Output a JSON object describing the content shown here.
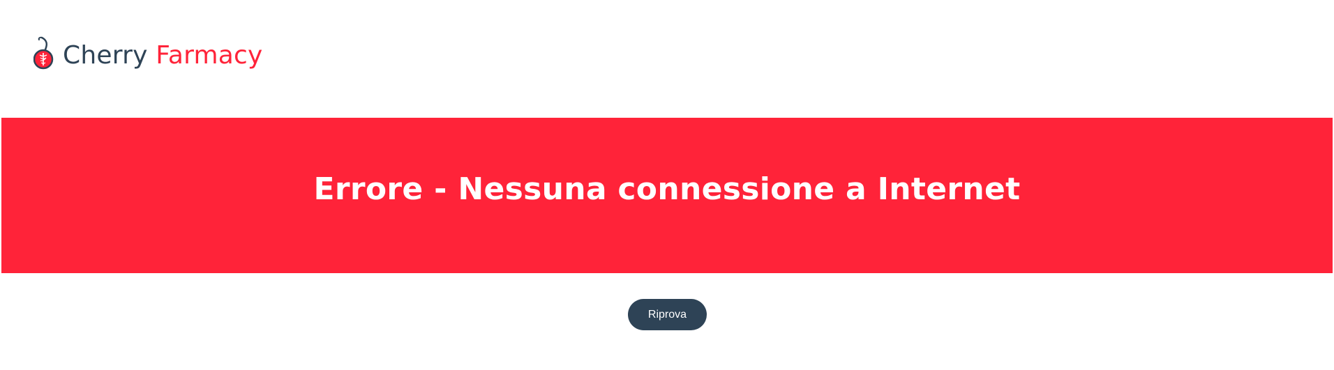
{
  "brand": {
    "name_part1": "Cherry",
    "name_part2": "Farmacy",
    "logo_icon": "cherry-caduceus-icon",
    "colors": {
      "dark": "#2e4356",
      "accent": "#ff2339"
    }
  },
  "banner": {
    "title": "Errore - Nessuna connessione a Internet",
    "background": "#ff2339"
  },
  "actions": {
    "retry_label": "Riprova"
  }
}
